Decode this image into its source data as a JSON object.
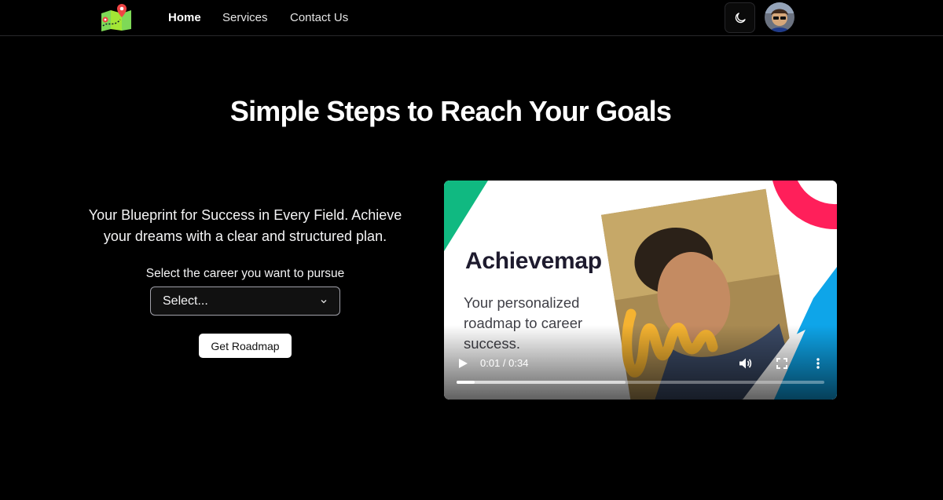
{
  "nav": {
    "links": [
      {
        "label": "Home",
        "active": true
      },
      {
        "label": "Services",
        "active": false
      },
      {
        "label": "Contact Us",
        "active": false
      }
    ],
    "theme_icon": "moon-icon",
    "logo_icon": "map-pin-logo",
    "avatar_icon": "user-avatar"
  },
  "hero": {
    "title": "Simple Steps to Reach Your Goals"
  },
  "career_form": {
    "tagline": "Your Blueprint for Success in Every Field. Achieve your dreams with a clear and structured plan.",
    "select_label": "Select the career you want to pursue",
    "select_value": "Select...",
    "button_label": "Get Roadmap"
  },
  "video": {
    "title": "Achievemap",
    "subtitle": "Your personalized roadmap to career success.",
    "time": "0:01 / 0:34",
    "progress": 0.05,
    "buffered": 0.46
  },
  "colors": {
    "background": "#000000",
    "accent_green": "#10b981",
    "accent_pink": "#ff1f5a",
    "accent_blue": "#0ea5e9",
    "accent_yellow": "#f5b331"
  }
}
